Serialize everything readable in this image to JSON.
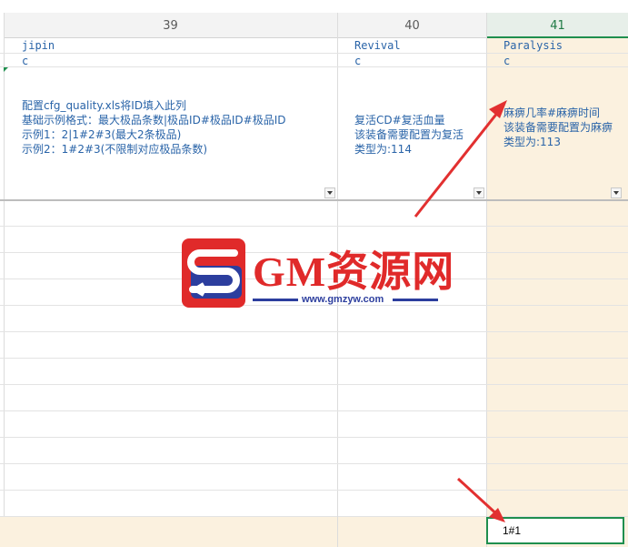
{
  "columns": [
    {
      "number": "39",
      "name": "jipin",
      "type": "c",
      "description": "配置cfg_quality.xls将ID填入此列\n基础示例格式：最大极品条数|极品ID#极品ID#极品ID\n示例1：2|1#2#3(最大2条极品)\n示例2：1#2#3(不限制对应极品条数)"
    },
    {
      "number": "40",
      "name": "Revival",
      "type": "c",
      "description": "复活CD#复活血量\n该装备需要配置为复活\n类型为:114"
    },
    {
      "number": "41",
      "name": "Paralysis",
      "type": "c",
      "description": "麻痹几率#麻痹时间\n该装备需要配置为麻痹\n类型为:113"
    }
  ],
  "active_cell": {
    "value": "1#1"
  },
  "watermark": {
    "brand": "GM资源网",
    "url": "www.gmzyw.com"
  },
  "colors": {
    "accent": "#1f8f4e",
    "selected_column": "#fbf1df",
    "text_blue": "#2a64a8",
    "arrow": "#e23030",
    "brand_red": "#e02a2a",
    "brand_blue": "#2c3e9e"
  },
  "icons": {
    "dropdown": "dropdown-arrow-icon",
    "comment_marker": "comment-indicator-icon"
  }
}
